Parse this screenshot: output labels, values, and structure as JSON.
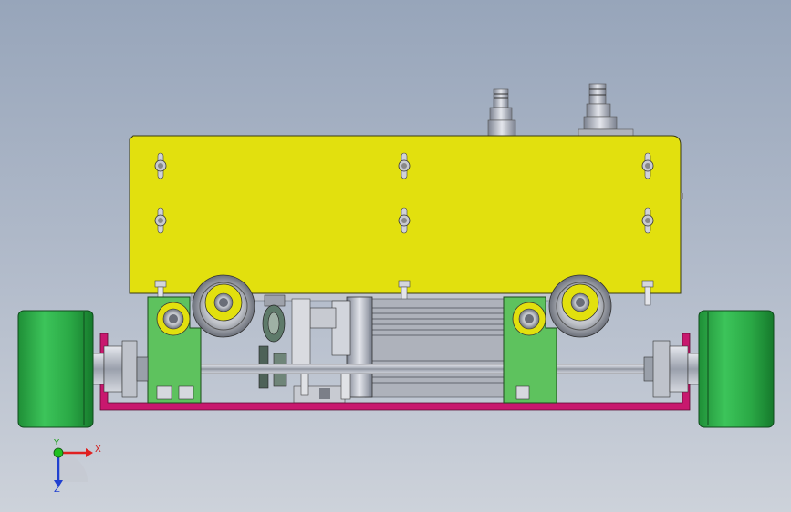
{
  "viewport": {
    "triad": {
      "x_label": "X",
      "y_label": "Y",
      "z_label": "Z"
    }
  },
  "colors": {
    "plate": "#e2e00e",
    "bracket": "#5ec25e",
    "wheel": "#2fb04b",
    "frame": "#c8186e",
    "metal": "#b8bcc6"
  }
}
